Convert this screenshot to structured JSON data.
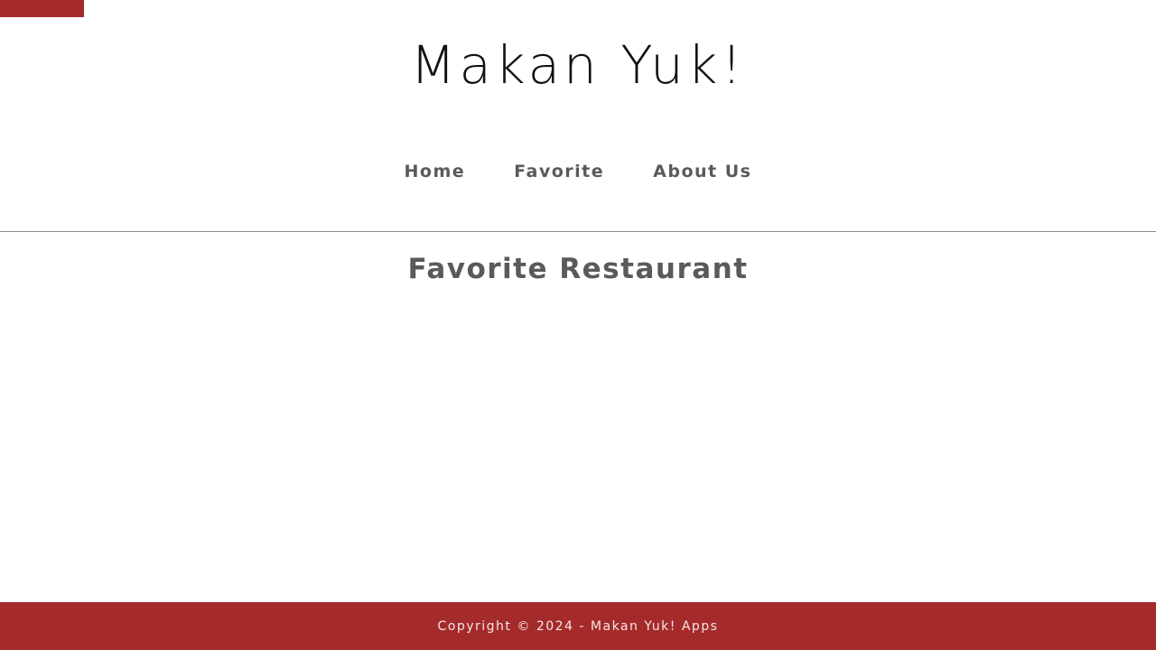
{
  "skip_link": {
    "label": ""
  },
  "header": {
    "title": "Makan Yuk!"
  },
  "nav": {
    "items": [
      {
        "label": "Home"
      },
      {
        "label": "Favorite"
      },
      {
        "label": "About Us"
      }
    ]
  },
  "main": {
    "title": "Favorite Restaurant",
    "restaurants": []
  },
  "footer": {
    "text": "Copyright © 2024 - Makan Yuk! Apps"
  },
  "colors": {
    "brand": "#a52a2a",
    "nav_text": "#5a5a5a",
    "title_text": "#111111"
  }
}
